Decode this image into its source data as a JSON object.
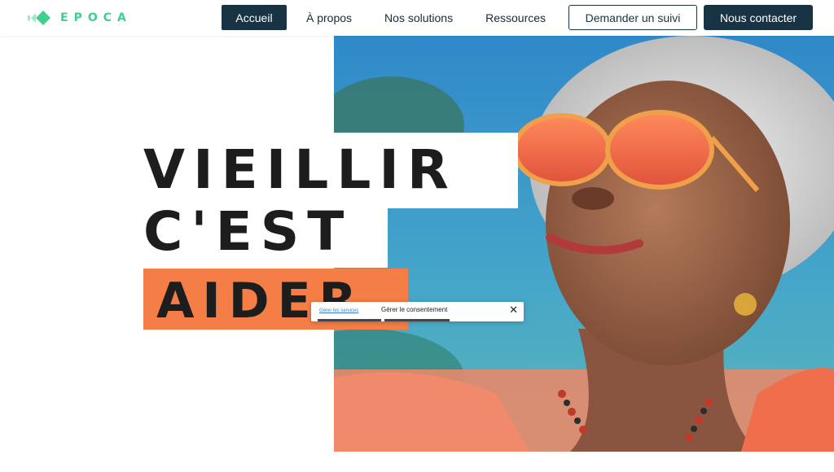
{
  "brand": {
    "name": "EPOCA",
    "color": "#3fcf8e"
  },
  "nav": {
    "items": [
      {
        "label": "Accueil",
        "active": true
      },
      {
        "label": "À propos",
        "active": false
      },
      {
        "label": "Nos solutions",
        "active": false
      },
      {
        "label": "Ressources",
        "active": false
      }
    ],
    "follow_label": "Demander un suivi",
    "contact_label": "Nous contacter"
  },
  "hero": {
    "line1": "VIEILLIR",
    "line2": "C'EST",
    "line3": "AIDER",
    "accent_color": "#f47e46",
    "image_icon": "photo-smiling-elderly-woman-sunglasses"
  },
  "consent": {
    "link_label": "Gérer les services",
    "title": "Gérer le consentement",
    "close_label": "✕"
  },
  "colors": {
    "dark": "#173344"
  }
}
